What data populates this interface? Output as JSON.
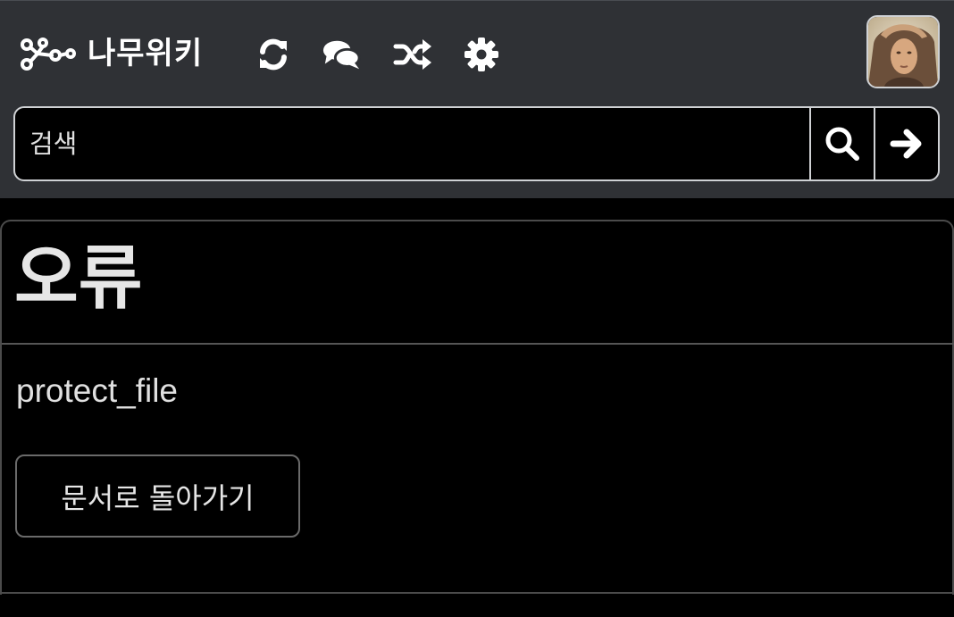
{
  "header": {
    "logo_text": "나무위키",
    "nav_icons": [
      "refresh-icon",
      "comments-icon",
      "random-icon",
      "settings-icon"
    ],
    "avatar": "user-avatar"
  },
  "search": {
    "placeholder": "검색",
    "value": "",
    "search_icon": "search-icon",
    "go_icon": "arrow-right-icon"
  },
  "main": {
    "title": "오류",
    "error_code": "protect_file",
    "back_button_label": "문서로 돌아가기"
  },
  "colors": {
    "header_bg": "#2f3135",
    "page_bg": "#000000",
    "text": "#e6e6e6",
    "border": "#cfd1d4"
  }
}
